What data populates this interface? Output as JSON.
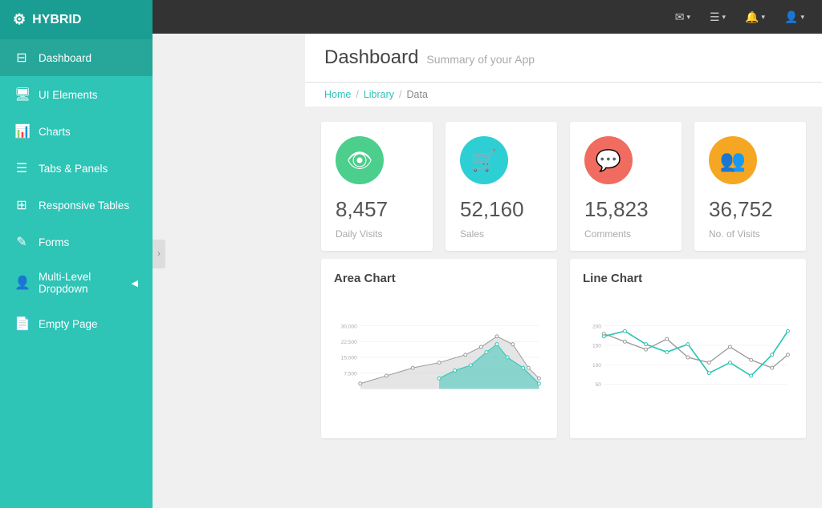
{
  "app": {
    "name": "HYBRID"
  },
  "topbar": {
    "buttons": [
      {
        "label": "✉",
        "caret": "▾",
        "name": "mail-btn"
      },
      {
        "label": "☰",
        "caret": "▾",
        "name": "menu-btn"
      },
      {
        "label": "🔔",
        "caret": "▾",
        "name": "notification-btn"
      },
      {
        "label": "👤",
        "caret": "▾",
        "name": "user-btn"
      }
    ]
  },
  "sidebar": {
    "items": [
      {
        "label": "Dashboard",
        "icon": "⊟",
        "active": true,
        "name": "dashboard"
      },
      {
        "label": "UI Elements",
        "icon": "🖥",
        "active": false,
        "name": "ui-elements"
      },
      {
        "label": "Charts",
        "icon": "📊",
        "active": false,
        "name": "charts"
      },
      {
        "label": "Tabs & Panels",
        "icon": "☰",
        "active": false,
        "name": "tabs-panels"
      },
      {
        "label": "Responsive Tables",
        "icon": "⊞",
        "active": false,
        "name": "responsive-tables"
      },
      {
        "label": "Forms",
        "icon": "✎",
        "active": false,
        "name": "forms"
      },
      {
        "label": "Multi-Level Dropdown",
        "icon": "👤",
        "active": false,
        "name": "multi-level",
        "arrow": "◀"
      },
      {
        "label": "Empty Page",
        "icon": "📄",
        "active": false,
        "name": "empty-page"
      }
    ]
  },
  "page": {
    "title": "Dashboard",
    "subtitle": "Summary of your App"
  },
  "breadcrumb": {
    "items": [
      "Home",
      "Library",
      "Data"
    ]
  },
  "stats": [
    {
      "value": "8,457",
      "label": "Daily Visits",
      "color": "#4cce8c",
      "icon": "👁"
    },
    {
      "value": "52,160",
      "label": "Sales",
      "color": "#2ecfd4",
      "icon": "🛒"
    },
    {
      "value": "15,823",
      "label": "Comments",
      "color": "#f06c60",
      "icon": "💬"
    },
    {
      "value": "36,752",
      "label": "No. of Visits",
      "color": "#f5a623",
      "icon": "👥"
    }
  ],
  "charts": {
    "area": {
      "title": "Area Chart",
      "yLabels": [
        "30,000",
        "22,500",
        "15,000",
        "7,500",
        ""
      ],
      "color1": "#aaa",
      "color2": "#2ec4b6"
    },
    "line": {
      "title": "Line Chart",
      "yLabels": [
        "200",
        "150",
        "100",
        "50",
        ""
      ],
      "color1": "#aaa",
      "color2": "#2ec4b6"
    }
  }
}
